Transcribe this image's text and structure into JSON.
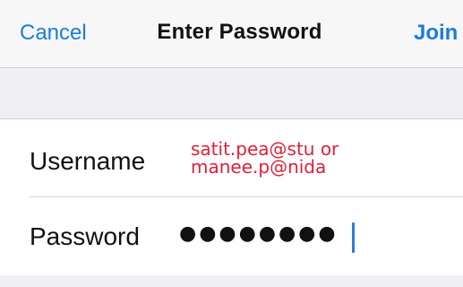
{
  "navbar": {
    "cancel_label": "Cancel",
    "title": "Enter Password",
    "join_label": "Join",
    "accent_color": "#1a7ed6"
  },
  "form": {
    "username": {
      "label": "Username",
      "annotation_line1": "satit.pea@stu or",
      "annotation_line2": "manee.p@nida",
      "annotation_color": "#e0203a"
    },
    "password": {
      "label": "Password",
      "masked_value": "●●●●●●●●",
      "caret_color": "#2a7fe0"
    }
  }
}
